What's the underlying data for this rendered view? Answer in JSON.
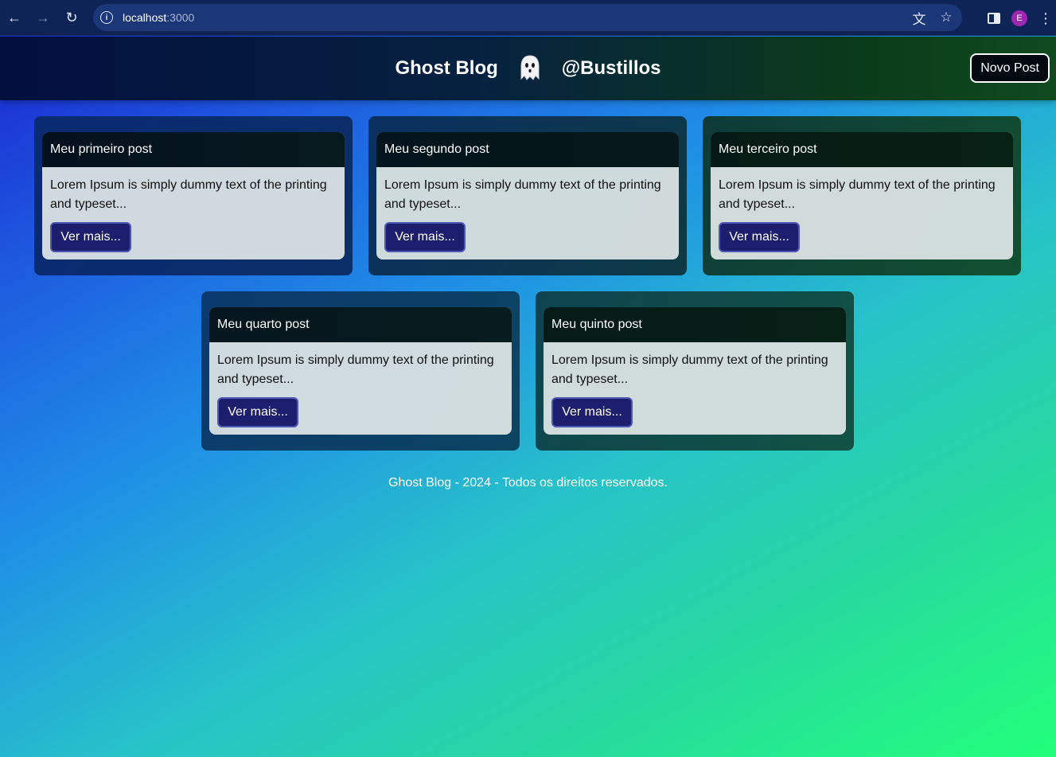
{
  "browser": {
    "url_host": "localhost",
    "url_port": ":3000",
    "avatar_letter": "E"
  },
  "header": {
    "title": "Ghost Blog",
    "handle": "@Bustillos",
    "new_post_label": "Novo Post"
  },
  "posts": [
    {
      "title": "Meu primeiro post",
      "excerpt": "Lorem Ipsum is simply dummy text of the printing and typeset...",
      "button": "Ver mais..."
    },
    {
      "title": "Meu segundo post",
      "excerpt": "Lorem Ipsum is simply dummy text of the printing and typeset...",
      "button": "Ver mais..."
    },
    {
      "title": "Meu terceiro post",
      "excerpt": "Lorem Ipsum is simply dummy text of the printing and typeset...",
      "button": "Ver mais..."
    },
    {
      "title": "Meu quarto post",
      "excerpt": "Lorem Ipsum is simply dummy text of the printing and typeset...",
      "button": "Ver mais..."
    },
    {
      "title": "Meu quinto post",
      "excerpt": "Lorem Ipsum is simply dummy text of the printing and typeset...",
      "button": "Ver mais..."
    }
  ],
  "footer": {
    "text": "Ghost Blog - 2024 - Todos os direitos reservados."
  },
  "colors": {
    "button_bg": "#1d1f6e",
    "header_dark": "#020f3d"
  }
}
